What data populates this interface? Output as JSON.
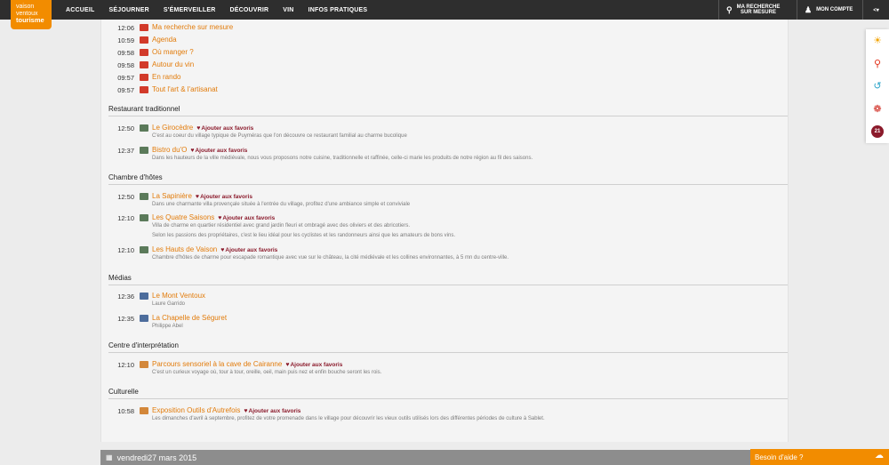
{
  "logo": {
    "line1": "vaison",
    "line2": "ventoux",
    "line3": "tourisme"
  },
  "nav": {
    "items": [
      "ACCUEIL",
      "SÉJOURNER",
      "S'ÉMERVEILLER",
      "DÉCOUVRIR",
      "VIN",
      "INFOS PRATIQUES"
    ],
    "search_line1": "MA RECHERCHE",
    "search_line2": "SUR MESURE",
    "account": "MON COMPTE",
    "search_icon": "search-icon",
    "account_icon": "user-icon",
    "share_icon": "share-icon"
  },
  "fav_label": "Ajouter aux favoris",
  "recent": [
    {
      "time": "12:06",
      "label": "Ma recherche sur mesure"
    },
    {
      "time": "10:59",
      "label": "Agenda"
    },
    {
      "time": "09:58",
      "label": "Où manger ?"
    },
    {
      "time": "09:58",
      "label": "Autour du vin"
    },
    {
      "time": "09:57",
      "label": "En rando"
    },
    {
      "time": "09:57",
      "label": "Tout l'art & l'artisanat"
    }
  ],
  "sections": {
    "restaurant": {
      "title": "Restaurant traditionnel",
      "items": [
        {
          "time": "12:50",
          "label": "Le Girocèdre",
          "desc": [
            "C'est au coeur du village typique de Puyméras que l'on découvre ce restaurant familial au charme bucolique"
          ]
        },
        {
          "time": "12:37",
          "label": "Bistro du'O",
          "desc": [
            "Dans les hauteurs de la ville médiévale, nous vous proposons notre cuisine, traditionnelle et raffinée, celle-ci marie les produits de notre région au fil des saisons."
          ]
        }
      ]
    },
    "chambre": {
      "title": "Chambre d'hôtes",
      "items": [
        {
          "time": "12:50",
          "label": "La Sapinière",
          "desc": [
            "Dans une charmante villa provençale située à l'entrée du village, profitez d'une ambiance simple et conviviale"
          ]
        },
        {
          "time": "12:10",
          "label": "Les Quatre Saisons",
          "desc": [
            "Villa de charme en quartier résidentiel avec grand jardin fleuri et ombragé avec des oliviers et des abricotiers.",
            "Selon les passions des propriétaires, c'est le lieu idéal pour les cyclistes et les randonneurs ainsi que les amateurs de bons vins."
          ]
        },
        {
          "time": "12:10",
          "label": "Les Hauts de Vaison",
          "desc": [
            "Chambre d'hôtes de charme pour escapade romantique avec vue sur le château, la cité médiévale et les collines environnantes, à 5 mn du centre-ville."
          ]
        }
      ]
    },
    "medias": {
      "title": "Médias",
      "items": [
        {
          "time": "12:36",
          "label": "Le Mont Ventoux",
          "desc": [
            "Laure Garrido"
          ]
        },
        {
          "time": "12:35",
          "label": "La Chapelle de Séguret",
          "desc": [
            "Philippe Abel"
          ]
        }
      ]
    },
    "centre": {
      "title": "Centre d'interprétation",
      "items": [
        {
          "time": "12:10",
          "label": "Parcours sensoriel à la cave de Cairanne",
          "desc": [
            "C'est un curieux voyage où, tour à tour, oreille, oeil, main puis nez et enfin bouche seront les rois."
          ]
        }
      ]
    },
    "culturelle": {
      "title": "Culturelle",
      "items": [
        {
          "time": "10:58",
          "label": "Exposition Outils d'Autrefois",
          "desc": [
            "Les dimanches d'avril à septembre, profitez de votre promenade dans le village pour découvrir les vieux outils utilisés lors des différentes périodes de culture à Sablet."
          ]
        }
      ]
    }
  },
  "datebar": {
    "label": "vendredi27 mars 2015",
    "icon": "calendar-icon"
  },
  "sidebar": {
    "badge": "21"
  },
  "help": {
    "label": "Besoin d'aide ?"
  }
}
